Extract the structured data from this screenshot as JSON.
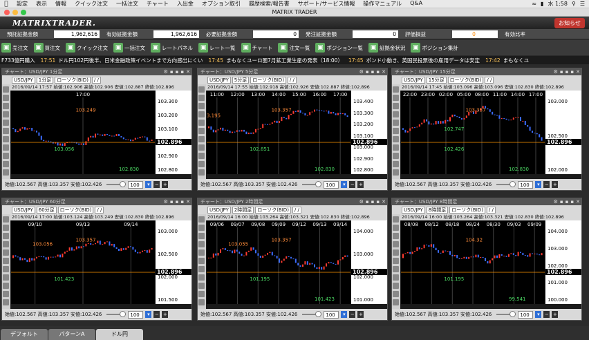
{
  "menubar": {
    "items": [
      "設定",
      "表示",
      "情報",
      "クイック注文",
      "一括注文",
      "チャート",
      "入出金",
      "オプション取引",
      "履歴検索/報告書",
      "サポート/サービス情報",
      "操作マニュアル",
      "Q&A"
    ],
    "time": "水 1:58"
  },
  "window": {
    "title": "MATRIX TRADER"
  },
  "brand": {
    "logo": "MATRIXTRADER.",
    "notice": "お知らせ"
  },
  "account": [
    {
      "label": "預託証拠金額",
      "value": "1,962,616"
    },
    {
      "label": "有効証拠金額",
      "value": "1,962,616"
    },
    {
      "label": "必要証拠金額",
      "value": "0"
    },
    {
      "label": "発注証拠金額",
      "value": "0"
    },
    {
      "label": "評価損益",
      "value": "0"
    },
    {
      "label": "有効比率",
      "value": ""
    }
  ],
  "toolbar": [
    "売注文",
    "買注文",
    "クイック注文",
    "一括注文",
    "レートパネル",
    "レート一覧",
    "チャート",
    "注文一覧",
    "ポジション一覧",
    "証拠金状況",
    "ポジション集計"
  ],
  "news": [
    {
      "time": "",
      "text": "F733億円購入"
    },
    {
      "time": "17:51",
      "text": "ドル円102円後半、日米金融政策イベントまで方向感出にくい"
    },
    {
      "time": "17:45",
      "text": "まもなくユーロ圏7月鉱工業生産の発表（18:00）"
    },
    {
      "time": "17:45",
      "text": "ポンド小動き、英国民投票後の雇用データは安定"
    },
    {
      "time": "17:42",
      "text": "まもなくユ"
    }
  ],
  "panes": [
    {
      "title": "チャート：USD/JPY 1分足",
      "pair": "USD/JPY",
      "period": "1分足",
      "type": "ローソク(BID)",
      "date": "/ /",
      "info": "2016/09/14 17:57 始値:102.906 高値:102.906 安値:102.887 終値:102.896",
      "xticks": [
        "17:00"
      ],
      "yticks": [
        "103.300",
        "103.200",
        "103.100",
        "103.000",
        "102.900",
        "102.800"
      ],
      "current": "102.896",
      "hi": "103.249",
      "lo": "103.056",
      "lo2": "102.830",
      "foot": "始値:102.567 高値:103.357 安値:102.426",
      "zoom": "100"
    },
    {
      "title": "チャート：USD/JPY 5分足",
      "pair": "USD/JPY",
      "period": "5分足",
      "type": "ローソク(BID)",
      "date": "/ /",
      "info": "2016/09/14 17:55 始値:102.918 高値:102.926 安値:102.887 終値:102.896",
      "xticks": [
        "11:00",
        "12:00",
        "13:00",
        "14:00",
        "15:00",
        "16:00",
        "17:00"
      ],
      "yticks": [
        "103.400",
        "103.300",
        "103.200",
        "103.100",
        "103.000",
        "102.900",
        "102.800"
      ],
      "current": "102.896",
      "hi": "103.357",
      "lo": "102.851",
      "lo2": "102.830",
      "left": "3.195",
      "foot": "始値:102.567 高値:103.357 安値:102.426",
      "zoom": "100"
    },
    {
      "title": "チャート：USD/JPY 15分足",
      "pair": "USD/JPY",
      "period": "15分足",
      "type": "ローソク(BID)",
      "date": "/ /",
      "info": "2016/09/14 17:45 始値:103.096 高値:103.096 安値:102.830 終値:102.896",
      "xticks": [
        "22:00",
        "23:00",
        "02:00",
        "05:00",
        "08:00",
        "11:00",
        "14:00",
        "17:00"
      ],
      "yticks": [
        "103.000",
        "102.500",
        "102.000"
      ],
      "current": "102.896",
      "hi": "103.357",
      "lo": "102.426",
      "lo2": "102.830",
      "mid": "102.747",
      "foot": "始値:102.567 高値:103.357 安値:102.426",
      "zoom": "100"
    },
    {
      "title": "チャート：USD/JPY 60分足",
      "pair": "USD/JPY",
      "period": "60分足",
      "type": "ローソク(BID)",
      "date": "/ /",
      "info": "2016/09/14 17:00 始値:103.124 高値:103.249 安値:102.830 終値:102.896",
      "xticks": [
        "09/10",
        "09/13",
        "09/14"
      ],
      "yticks": [
        "103.000",
        "102.500",
        "102.000",
        "101.500"
      ],
      "current": "102.896",
      "hi": "103.357",
      "hi2": "103.056",
      "lo": "101.423",
      "foot": "始値:102.567 高値:103.357 安値:102.426",
      "zoom": "100"
    },
    {
      "title": "チャート：USD/JPY 2時間足",
      "pair": "USD/JPY",
      "period": "2時間足",
      "type": "ローソク(BID)",
      "date": "/ /",
      "info": "2016/09/14 16:00 始値:103.264 高値:103.321 安値:102.830 終値:102.896",
      "xticks": [
        "09/06",
        "09/07",
        "09/08",
        "09/09",
        "09/12",
        "09/13",
        "09/14"
      ],
      "yticks": [
        "104.000",
        "103.000",
        "102.000",
        "101.000"
      ],
      "current": "102.896",
      "hi": "103.357",
      "hi2": "103.055",
      "lo": "101.195",
      "lo2": "101.423",
      "foot": "始値:102.567 高値:103.357 安値:102.426",
      "zoom": "100"
    },
    {
      "title": "チャート：USD/JPY 8時間足",
      "pair": "USD/JPY",
      "period": "8時間足",
      "type": "ローソク(BID)",
      "date": "/ /",
      "info": "2016/09/14 16:00 始値:103.264 高値:103.321 安値:102.830 終値:102.896",
      "xticks": [
        "08/08",
        "08/12",
        "08/18",
        "08/24",
        "08/30",
        "09/03",
        "09/09"
      ],
      "yticks": [
        "104.000",
        "103.000",
        "102.000",
        "101.000",
        "100.000"
      ],
      "current": "102.896",
      "hi": "104.32",
      "lo": "101.195",
      "lo2": "99.541",
      "foot": "始値:102.567 高値:103.357 安値:102.426",
      "zoom": "100"
    }
  ],
  "tabs": [
    "デフォルト",
    "パターンA",
    "ドル円"
  ],
  "colors": {
    "up": "#ff3b30",
    "down": "#3b6cff",
    "curline": "#ff9500",
    "grid": "#404040"
  }
}
